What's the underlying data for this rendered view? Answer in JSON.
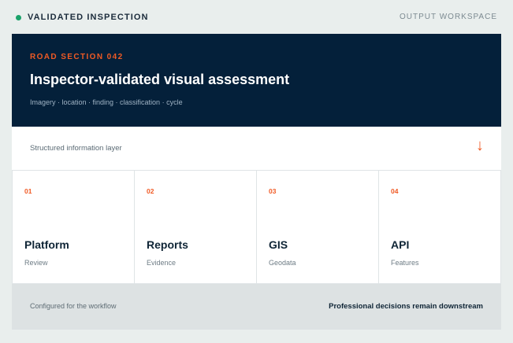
{
  "header": {
    "status_label": "VALIDATED INSPECTION",
    "workspace_label": "OUTPUT WORKSPACE",
    "status_color": "#1aa26a"
  },
  "hero": {
    "eyebrow": "ROAD SECTION 042",
    "title": "Inspector-validated visual assessment",
    "meta": "Imagery · location · finding · classification · cycle"
  },
  "layer": {
    "label": "Structured information layer",
    "icon": "arrow-down-icon"
  },
  "cards": [
    {
      "num": "01",
      "title": "Platform",
      "sub": "Review"
    },
    {
      "num": "02",
      "title": "Reports",
      "sub": "Evidence"
    },
    {
      "num": "03",
      "title": "GIS",
      "sub": "Geodata"
    },
    {
      "num": "04",
      "title": "API",
      "sub": "Features"
    }
  ],
  "footer": {
    "left": "Configured for the workflow",
    "right": "Professional decisions remain downstream"
  },
  "colors": {
    "accent": "#f05a24",
    "navy": "#04203a"
  }
}
